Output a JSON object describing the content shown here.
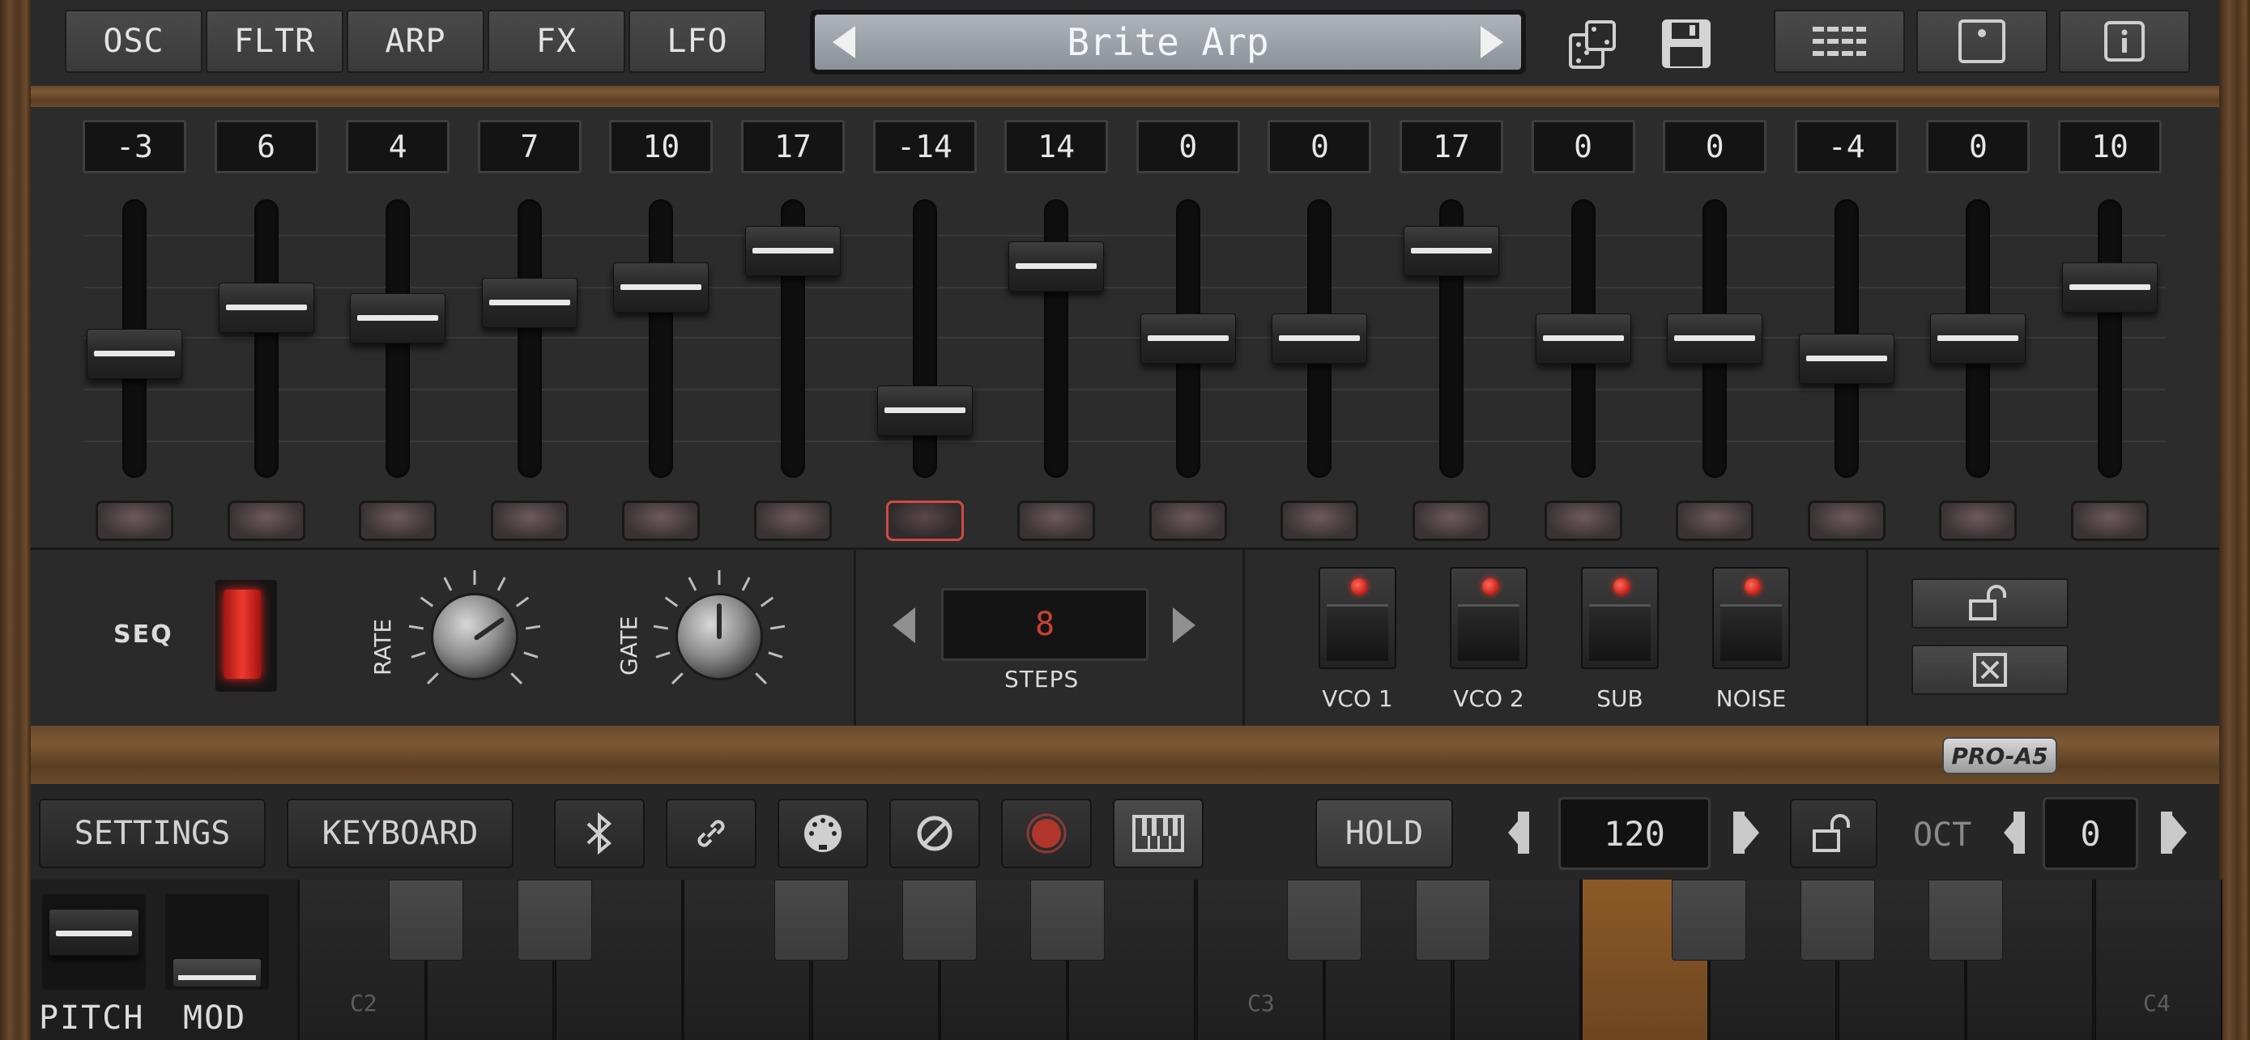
{
  "top_tabs": [
    "OSC",
    "FLTR",
    "ARP",
    "FX",
    "LFO"
  ],
  "preset_name": "Brite Arp",
  "step_values": [
    "-3",
    "6",
    "4",
    "7",
    "10",
    "17",
    "-14",
    "14",
    "0",
    "0",
    "17",
    "0",
    "0",
    "-4",
    "0",
    "10"
  ],
  "step_range": [
    -24,
    24
  ],
  "active_step": 7,
  "seq_label": "SEQ",
  "rate_label": "RATE",
  "gate_label": "GATE",
  "steps_value": "8",
  "steps_label": "STEPS",
  "toggles": [
    {
      "label": "VCO 1",
      "on": true
    },
    {
      "label": "VCO 2",
      "on": true
    },
    {
      "label": "SUB",
      "on": true
    },
    {
      "label": "NOISE",
      "on": true
    }
  ],
  "logo": "PRO-A5",
  "bottom": {
    "settings": "SETTINGS",
    "keyboard": "KEYBOARD",
    "hold": "HOLD",
    "tempo": "120",
    "oct_label": "OCT",
    "oct_value": "0"
  },
  "wheels": {
    "pitch": "PITCH",
    "mod": "MOD"
  },
  "keyboard_labels": {
    "c2": "C2",
    "c3": "C3",
    "c4": "C4"
  },
  "colors": {
    "accent_red": "#d24a42",
    "led": "#e8281e",
    "pressed_key": "#8c5a28"
  }
}
